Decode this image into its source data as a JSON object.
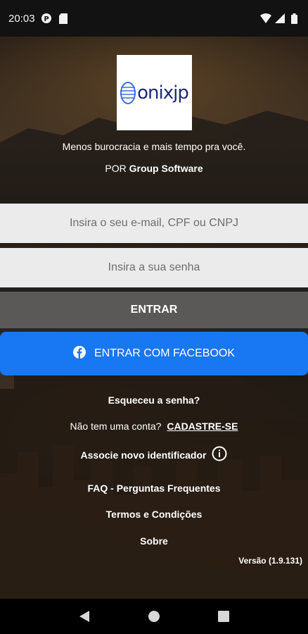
{
  "status_bar": {
    "time": "20:03",
    "icons": [
      "notification-app-icon",
      "sd-card-icon",
      "wifi-icon",
      "signal-icon",
      "battery-icon"
    ]
  },
  "logo": {
    "text": "onixjp",
    "subtext": ""
  },
  "tagline": "Menos burocracia e mais tempo pra você.",
  "byline": {
    "prefix": "POR",
    "company": "Group Software"
  },
  "form": {
    "email_placeholder": "Insira o seu e-mail, CPF ou CNPJ",
    "password_placeholder": "Insira a sua senha",
    "login_label": "ENTRAR",
    "facebook_label": "ENTRAR COM FACEBOOK"
  },
  "links": {
    "forgot": "Esqueceu a senha?",
    "no_account": "Não tem uma conta?",
    "signup": "CADASTRE-SE",
    "associate": "Associe novo identificador",
    "faq": "FAQ - Perguntas Frequentes",
    "terms": "Termos e Condições",
    "about": "Sobre"
  },
  "version": "Versão (1.9.131)",
  "colors": {
    "facebook_blue": "#1877f2",
    "login_button": "#5b5957",
    "field_bg": "#ebebeb",
    "logo_blue": "#1d2a78"
  },
  "nav": {
    "buttons": [
      "back-icon",
      "home-icon",
      "recents-icon"
    ]
  }
}
